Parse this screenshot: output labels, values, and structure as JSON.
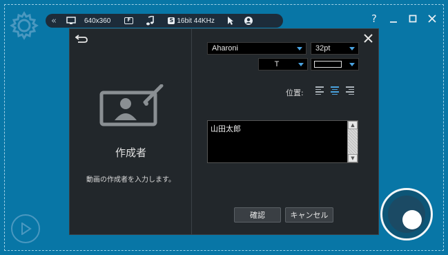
{
  "toolbar": {
    "collapse_icon": "double-chevron-left-icon",
    "resolution": "640x360",
    "format_badge": "F",
    "audio_badge": "S",
    "audio_quality": "16bit 44KHz"
  },
  "window": {
    "help": "?",
    "minimize": "—",
    "maximize": "☐",
    "close": "✕"
  },
  "dialog": {
    "back_icon": "↩",
    "close_icon": "✕",
    "left": {
      "title": "作成者",
      "description": "動画の作成者を入力します。"
    },
    "font": {
      "family": "Aharoni",
      "size": "32pt",
      "style": "T",
      "color": "#000000"
    },
    "position_label": "位置:",
    "alignment": {
      "options": [
        "left",
        "center",
        "right"
      ],
      "selected": "center"
    },
    "text_value": "山田太郎",
    "buttons": {
      "confirm": "確認",
      "cancel": "キャンセル"
    }
  },
  "colors": {
    "background": "#0876a6",
    "dialog": "#22272b",
    "accent": "#4aa3e0"
  }
}
